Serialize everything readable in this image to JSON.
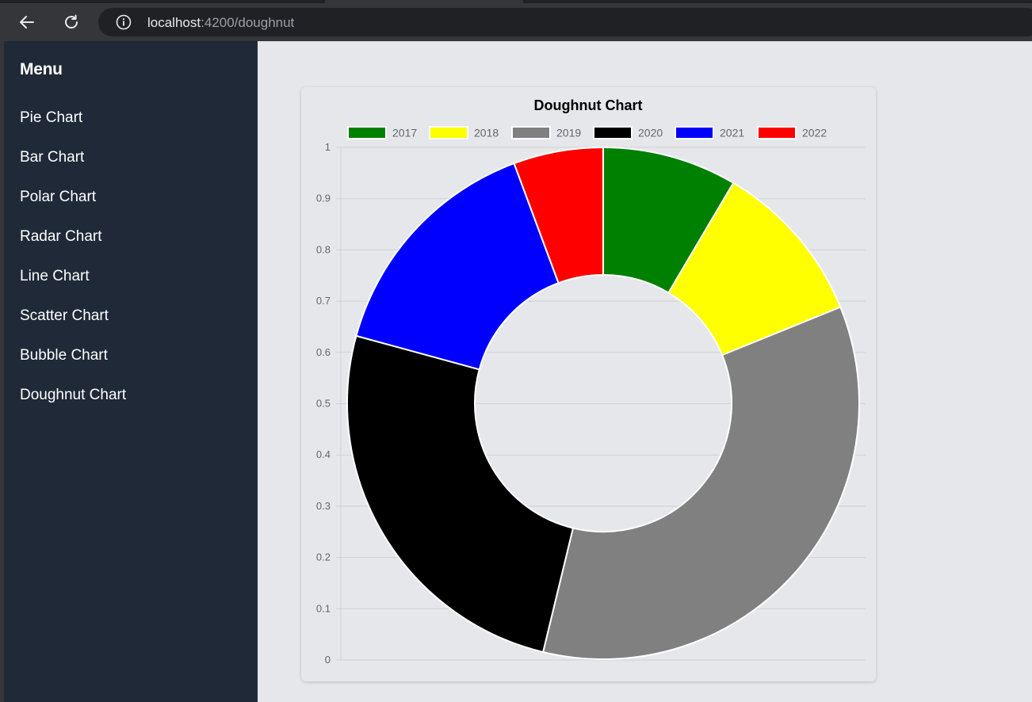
{
  "browser": {
    "url_host": "localhost",
    "url_path": ":4200/doughnut"
  },
  "sidebar": {
    "title": "Menu",
    "items": [
      {
        "label": "Pie Chart"
      },
      {
        "label": "Bar Chart"
      },
      {
        "label": "Polar Chart"
      },
      {
        "label": "Radar Chart"
      },
      {
        "label": "Line Chart"
      },
      {
        "label": "Scatter Chart"
      },
      {
        "label": "Bubble Chart"
      },
      {
        "label": "Doughnut Chart"
      }
    ]
  },
  "colors": {
    "sidebar_bg": "#1f2937",
    "content_bg": "#e5e7eb"
  },
  "chart_data": {
    "type": "doughnut",
    "title": "Doughnut Chart",
    "categories": [
      "2017",
      "2018",
      "2019",
      "2020",
      "2021",
      "2022"
    ],
    "values": [
      9,
      11,
      37,
      27,
      16,
      6
    ],
    "colors": [
      "#008000",
      "#ffff00",
      "#808080",
      "#000000",
      "#0000ff",
      "#ff0000"
    ],
    "yticks": [
      "0",
      "0.1",
      "0.2",
      "0.3",
      "0.4",
      "0.5",
      "0.6",
      "0.7",
      "0.8",
      "0.9",
      "1"
    ],
    "ylim": [
      0,
      1
    ],
    "grid": true,
    "legend_position": "top"
  }
}
